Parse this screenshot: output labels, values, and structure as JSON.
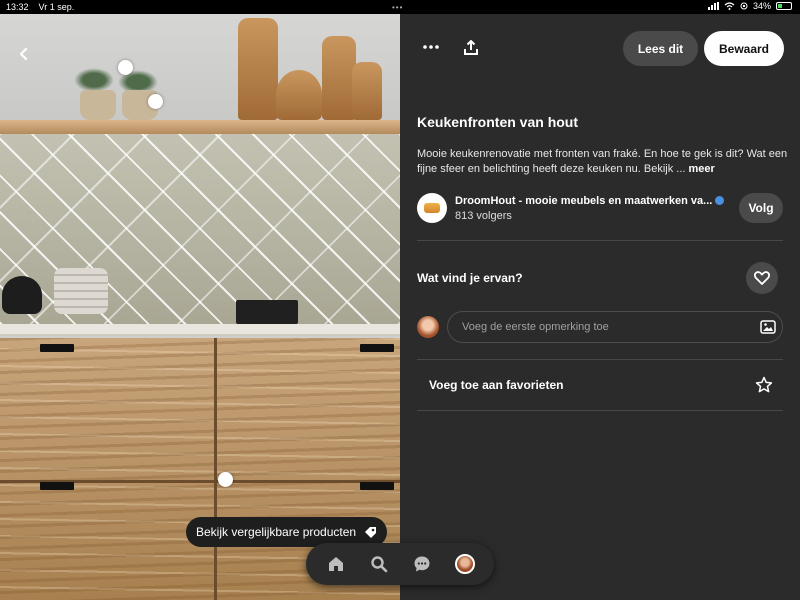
{
  "status_bar": {
    "time": "13:32",
    "date": "Vr 1 sep.",
    "battery": "34%",
    "battery_level": 0.34
  },
  "image_panel": {
    "similar_products_label": "Bekijk vergelijkbare producten",
    "icons": [
      "chevron-left-icon",
      "tag-icon"
    ]
  },
  "bottom_nav": {
    "items": [
      "home-icon",
      "search-icon",
      "messages-icon",
      "profile-avatar"
    ]
  },
  "pin": {
    "read_button": "Lees dit",
    "save_button": "Bewaard",
    "title": "Keukenfronten van hout",
    "description": "Mooie keukenrenovatie met fronten van fraké. En hoe te gek is dit? Wat een fijne sfeer en belichting heeft deze keuken nu. Bekijk ...",
    "more_label": "meer"
  },
  "creator": {
    "name": "DroomHout - mooie meubels en maatwerken va...",
    "followers": "813 volgers",
    "follow_button": "Volg"
  },
  "reaction": {
    "label": "Wat vind je ervan?"
  },
  "comment": {
    "placeholder": "Voeg de eerste opmerking toe"
  },
  "favorites": {
    "label": "Voeg toe aan favorieten"
  },
  "colors": {
    "panel_bg": "#2b2b2b",
    "save_bg": "#ffffff",
    "secondary_btn": "#4a4a4a"
  }
}
